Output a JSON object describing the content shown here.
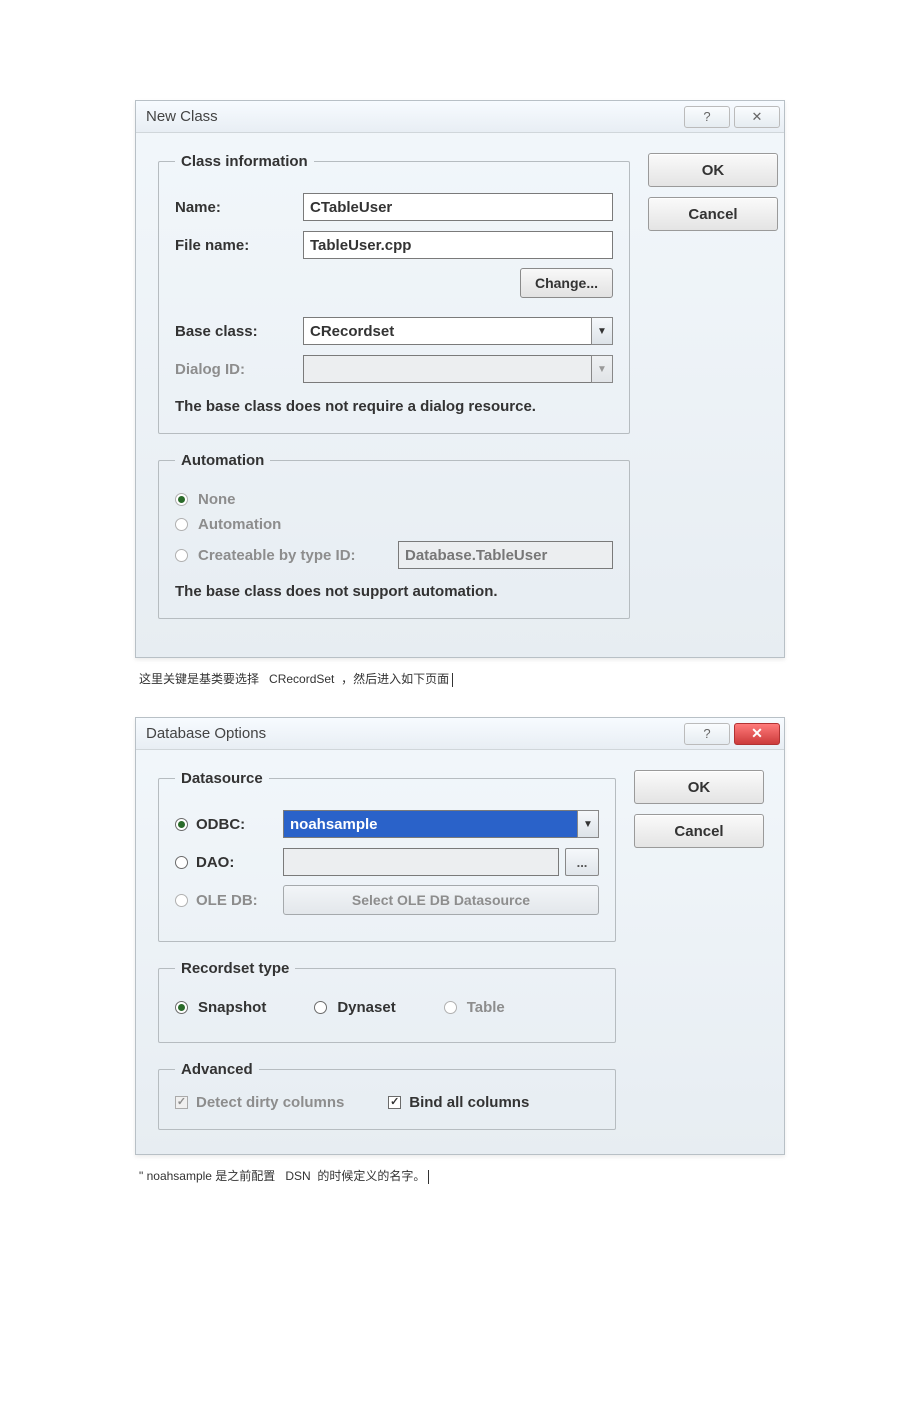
{
  "dialog1": {
    "title": "New Class",
    "ok": "OK",
    "cancel": "Cancel",
    "class_info": {
      "legend": "Class information",
      "name_label": "Name:",
      "name_value": "CTableUser",
      "file_label": "File name:",
      "file_value": "TableUser.cpp",
      "change_label": "Change...",
      "base_label": "Base class:",
      "base_value": "CRecordset",
      "dlgid_label": "Dialog ID:",
      "dlgid_value": "",
      "note": "The base class does not require a dialog resource."
    },
    "automation": {
      "legend": "Automation",
      "none": "None",
      "automation": "Automation",
      "createable": "Createable by type ID:",
      "typeid_value": "Database.TableUser",
      "note": "The base class does not support automation."
    }
  },
  "caption1_a": "这里关键是基类要选择",
  "caption1_b": "CRecordSet",
  "caption1_c": "，然后进入如下页面",
  "dialog2": {
    "title": "Database Options",
    "ok": "OK",
    "cancel": "Cancel",
    "datasource": {
      "legend": "Datasource",
      "odbc": "ODBC:",
      "odbc_value": "noahsample",
      "dao": "DAO:",
      "dao_value": "",
      "oledb": "OLE DB:",
      "oledb_button": "Select OLE DB Datasource"
    },
    "recordset": {
      "legend": "Recordset type",
      "snapshot": "Snapshot",
      "dynaset": "Dynaset",
      "table": "Table"
    },
    "advanced": {
      "legend": "Advanced",
      "detect": "Detect dirty columns",
      "bind": "Bind all columns"
    }
  },
  "caption2_a": "\" noahsample 是之前配置",
  "caption2_b": "DSN",
  "caption2_c": "的时候定义的名字。"
}
